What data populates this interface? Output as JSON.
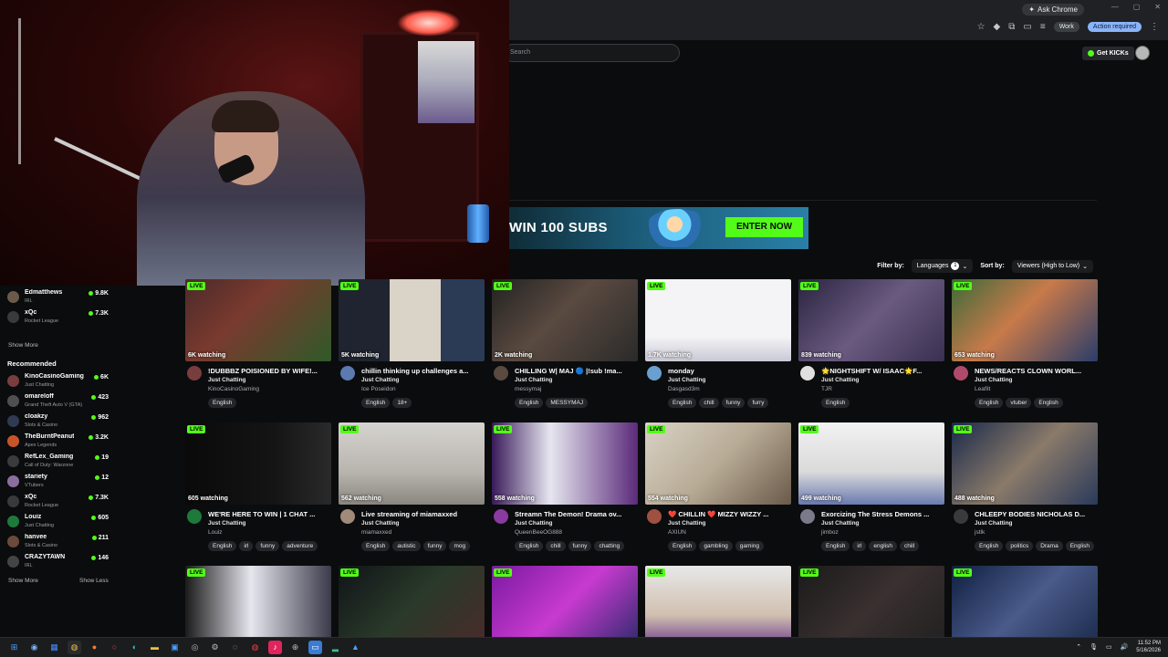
{
  "browser": {
    "ask_chrome": "Ask Chrome",
    "profile_label": "Work",
    "action_required": "Action required"
  },
  "kick": {
    "search_placeholder": "Search",
    "get_kicks": "Get KICKs",
    "banner_title": "WIN 100 SUBS",
    "banner_cta": "ENTER NOW",
    "filter_label": "Filter by:",
    "languages_label": "Languages",
    "languages_count": "1",
    "sort_label": "Sort by:",
    "sort_value": "Viewers (High to Low)"
  },
  "sidebar": {
    "following_partial": [
      {
        "name": "Edmatthews",
        "category": "IRL",
        "count": "9.8K",
        "color": "#6b5a4a"
      },
      {
        "name": "xQc",
        "category": "Rocket League",
        "count": "7.3K",
        "color": "#3a3a3a"
      }
    ],
    "show_more_1": "Show More",
    "recommended_title": "Recommended",
    "recommended": [
      {
        "name": "KinoCasinoGaming",
        "category": "Just Chatting",
        "count": "6K",
        "color": "#7a3d3d"
      },
      {
        "name": "omareloff",
        "category": "Grand Theft Auto V (GTA)",
        "count": "423",
        "color": "#4f4f4f"
      },
      {
        "name": "cloakzy",
        "category": "Slots & Casino",
        "count": "962",
        "color": "#2f3b52"
      },
      {
        "name": "TheBurntPeanut",
        "category": "Apex Legends",
        "count": "3.2K",
        "color": "#c8552a"
      },
      {
        "name": "RefLex_Gaming",
        "category": "Call of Duty: Warzone",
        "count": "19",
        "color": "#3b3b3b"
      },
      {
        "name": "stariety",
        "category": "VTubers",
        "count": "12",
        "color": "#8a6f9e"
      },
      {
        "name": "xQc",
        "category": "Rocket League",
        "count": "7.3K",
        "color": "#3a3a3a"
      },
      {
        "name": "Louiz",
        "category": "Just Chatting",
        "count": "605",
        "color": "#1d7a3a"
      },
      {
        "name": "hanvee",
        "category": "Slots & Casino",
        "count": "211",
        "color": "#6a4a3a"
      },
      {
        "name": "CRAZYTAWN",
        "category": "IRL",
        "count": "146",
        "color": "#444"
      }
    ],
    "show_more_2": "Show More",
    "show_less": "Show Less"
  },
  "streams": [
    {
      "title": "!DUBBBZ POISIONED BY WIFE!...",
      "category": "Just Chatting",
      "user": "KinoCasinoGaming",
      "viewers": "6K watching",
      "tags": [
        "English"
      ],
      "thumb": "linear-gradient(135deg,#4a2a2a,#7a3a2e 40%,#2f5a2a)",
      "avatar": "#7a3d3d"
    },
    {
      "title": "chillin thinking up challenges a...",
      "category": "Just Chatting",
      "user": "Ice Poseidon",
      "viewers": "5K watching",
      "tags": [
        "English",
        "18+"
      ],
      "thumb": "linear-gradient(90deg,#1f2430 0 35%,#d9d3c8 35% 70%,#2b3a55 70%)",
      "avatar": "#5a7ab0"
    },
    {
      "title": "CHILLING W| MAJ 🔵 |!sub !ma...",
      "category": "Just Chatting",
      "user": "messymaj",
      "viewers": "2K watching",
      "tags": [
        "English",
        "MESSYMAJ"
      ],
      "thumb": "linear-gradient(135deg,#222,#5a4a40 45%,#2a2a2a)",
      "avatar": "#5a4a40"
    },
    {
      "title": "monday",
      "category": "Just Chatting",
      "user": "Dasgasd3m",
      "viewers": "1.7K watching",
      "tags": [
        "English",
        "chill",
        "funny",
        "furry"
      ],
      "thumb": "linear-gradient(180deg,#f4f4f6 0 70%,#c9c9d6)",
      "avatar": "#6aa0d0"
    },
    {
      "title": "🌟NIGHTSHIFT W/ ISAAC🌟F...",
      "category": "Just Chatting",
      "user": "TJR",
      "viewers": "839 watching",
      "tags": [
        "English"
      ],
      "thumb": "linear-gradient(135deg,#2a2440,#6a5a80 50%,#3a3050)",
      "avatar": "#e0e0e0"
    },
    {
      "title": "NEWS/REACTS CLOWN WORL...",
      "category": "Just Chatting",
      "user": "Leafilt",
      "viewers": "653 watching",
      "tags": [
        "English",
        "vtuber",
        "English"
      ],
      "thumb": "linear-gradient(135deg,#3d6a3a,#c87a4a 45%,#2a3d6a)",
      "avatar": "#b04a6a"
    },
    {
      "title": "WE'RE HERE TO WIN | 1 CHAT ...",
      "category": "Just Chatting",
      "user": "Louiz",
      "viewers": "605 watching",
      "tags": [
        "English",
        "irl",
        "funny",
        "adventure"
      ],
      "thumb": "linear-gradient(90deg,#0a0a0a,#141414 60%,#2a2a2a)",
      "avatar": "#1d7a3a"
    },
    {
      "title": "Live streaming of miamaxxed",
      "category": "Just Chatting",
      "user": "miamaxxed",
      "viewers": "562 watching",
      "tags": [
        "English",
        "autistic",
        "funny",
        "mog"
      ],
      "thumb": "linear-gradient(180deg,#d6d4d0,#b8b4ae 60%,#8a8680)",
      "avatar": "#a08a7a"
    },
    {
      "title": "Streamn The Demon! Drama ov...",
      "category": "Just Chatting",
      "user": "QueenBeeOG888",
      "viewers": "558 watching",
      "tags": [
        "English",
        "chill",
        "funny",
        "chatting"
      ],
      "thumb": "linear-gradient(90deg,#3a1a5a,#e6e6f0 40%,#5a2a7a)",
      "avatar": "#8a3aa0"
    },
    {
      "title": "❤️ CHILLIN ❤️ MIZZY WIZZY ...",
      "category": "Just Chatting",
      "user": "AXIUN",
      "viewers": "554 watching",
      "tags": [
        "English",
        "gambling",
        "gaming"
      ],
      "thumb": "linear-gradient(135deg,#d8d2c4,#b8ab96 50%,#6a5a4a)",
      "avatar": "#a05040"
    },
    {
      "title": "Exorcizing The Stress Demons ...",
      "category": "Just Chatting",
      "user": "jimboz",
      "viewers": "499 watching",
      "tags": [
        "English",
        "irl",
        "english",
        "chill"
      ],
      "thumb": "linear-gradient(180deg,#f2f2f2,#dadada 60%,#6a7ab0)",
      "avatar": "#7a7a8a"
    },
    {
      "title": "CHLEEPY BODIES NICHOLAS D...",
      "category": "Just Chatting",
      "user": "jstlk",
      "viewers": "488 watching",
      "tags": [
        "English",
        "politics",
        "Drama",
        "English"
      ],
      "thumb": "linear-gradient(135deg,#1a2a4a,#8a7a6a 50%,#2a3a5a)",
      "avatar": "#3a3a3a"
    },
    {
      "title": "",
      "category": "",
      "user": "",
      "viewers": "",
      "tags": [],
      "thumb": "linear-gradient(90deg,#1a1a1a,#e6e6ee 45%,#3a3a4a)",
      "avatar": "#000"
    },
    {
      "title": "",
      "category": "",
      "user": "",
      "viewers": "",
      "tags": [],
      "thumb": "linear-gradient(135deg,#101418,#2a3a2a 50%,#4a2a2a)",
      "avatar": "#000"
    },
    {
      "title": "",
      "category": "",
      "user": "",
      "viewers": "",
      "tags": [],
      "thumb": "linear-gradient(135deg,#7a1aa0,#c83ad0 50%,#2a2a6a)",
      "avatar": "#000"
    },
    {
      "title": "",
      "category": "",
      "user": "",
      "viewers": "",
      "tags": [],
      "thumb": "linear-gradient(180deg,#e8e8e8,#d0c0b0 60%,#6a3a8a)",
      "avatar": "#000"
    },
    {
      "title": "",
      "category": "",
      "user": "",
      "viewers": "",
      "tags": [],
      "thumb": "linear-gradient(135deg,#1a1a1a,#3a3030 50%,#202020)",
      "avatar": "#000"
    },
    {
      "title": "",
      "category": "",
      "user": "",
      "viewers": "",
      "tags": [],
      "thumb": "linear-gradient(135deg,#102040,#4a5a8a 50%,#1a2a4a)",
      "avatar": "#000"
    }
  ],
  "taskbar": {
    "time": "11:52 PM",
    "date": "5/16/2026"
  },
  "colors": {
    "kick_green": "#53fc18",
    "bg": "#0b0c0d"
  }
}
